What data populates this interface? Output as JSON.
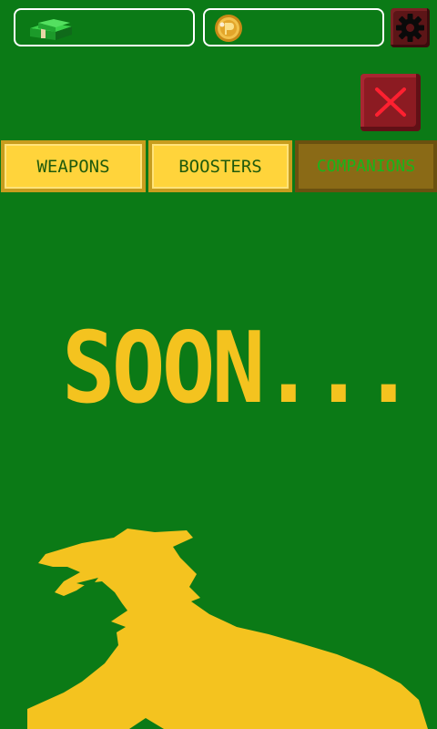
{
  "hud": {
    "cash_value": "",
    "coin_value": "",
    "cash_icon": "cash-stack-icon",
    "coin_icon": "gold-coin-icon",
    "settings_icon": "gear-icon"
  },
  "close_icon": "close-icon",
  "tabs": [
    {
      "label": "WEAPONS",
      "state": "active"
    },
    {
      "label": "BOOSTERS",
      "state": "active"
    },
    {
      "label": "COMPANIONS",
      "state": "selected"
    }
  ],
  "main": {
    "message": "SOON...",
    "illustration": "dog-silhouette"
  },
  "colors": {
    "background": "#0b7a16",
    "tab_fill": "#ffd43b",
    "tab_selected_fill": "#8a6a16",
    "accent_yellow": "#f4c31f",
    "close_red": "#8c1b22"
  }
}
